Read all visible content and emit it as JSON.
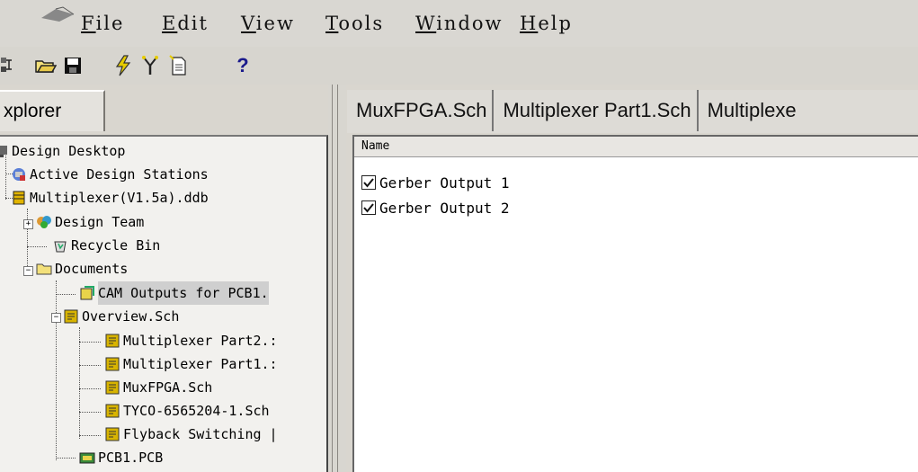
{
  "menu": {
    "file": {
      "mnemonic": "F",
      "rest": "ile"
    },
    "edit": {
      "mnemonic": "E",
      "rest": "dit"
    },
    "view": {
      "mnemonic": "V",
      "rest": "iew"
    },
    "tools": {
      "mnemonic": "T",
      "rest": "ools"
    },
    "window": {
      "mnemonic": "W",
      "rest": "indow"
    },
    "help": {
      "mnemonic": "H",
      "rest": "elp"
    }
  },
  "toolbar": {
    "help_glyph": "?",
    "icons": [
      "design-manager-icon",
      "open-folder-icon",
      "save-disk-icon",
      "lightning-icon",
      "probe-icon",
      "document-icon",
      "help-icon"
    ]
  },
  "explorer": {
    "tab_label": "xplorer",
    "tree": {
      "root": "Design Desktop",
      "stations": "Active Design Stations",
      "database": "Multiplexer(V1.5a).ddb",
      "team": "Design Team",
      "recycle": "Recycle Bin",
      "documents": "Documents",
      "cam": "CAM Outputs for PCB1.",
      "overview": "Overview.Sch",
      "part2": "Multiplexer Part2.:",
      "part1": "Multiplexer Part1.:",
      "muxfpga": "MuxFPGA.Sch",
      "tyco": "TYCO-6565204-1.Sch",
      "flyback": "Flyback Switching |",
      "pcb": "PCB1.PCB"
    }
  },
  "document_tabs": {
    "tab1": "MuxFPGA.Sch",
    "tab2": "Multiplexer Part1.Sch",
    "tab3": "Multiplexe"
  },
  "document_list": {
    "column_header": "Name",
    "items": [
      {
        "label": "Gerber Output 1",
        "checked": true
      },
      {
        "label": "Gerber Output 2",
        "checked": true
      }
    ]
  },
  "colors": {
    "chrome": "#d9d6cf",
    "panel": "#f2f1ee",
    "folder_yellow": "#e8d44a",
    "schematic_yellow": "#d8b400"
  }
}
